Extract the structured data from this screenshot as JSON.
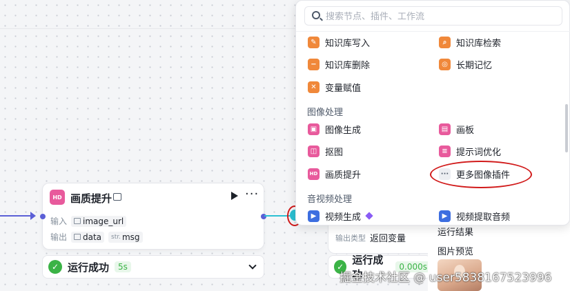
{
  "node": {
    "title": "画质提升",
    "input_label": "输入",
    "output_label": "输出",
    "input_param": "image_url",
    "output_params": [
      "data",
      "msg"
    ],
    "str_tag": "str.",
    "icon": "hd-icon"
  },
  "status_left": {
    "text": "运行成功",
    "time": "5s"
  },
  "node2": {
    "label": "输出类型",
    "value": "返回变量"
  },
  "status_right": {
    "text": "运行成功",
    "time": "0.000s"
  },
  "panel": {
    "search_placeholder": "搜索节点、插件、工作流",
    "items_top": [
      {
        "label": "知识库写入",
        "icon": "knowledge-write-icon",
        "color": "#f0883a"
      },
      {
        "label": "知识库检索",
        "icon": "knowledge-search-icon",
        "color": "#f0883a"
      },
      {
        "label": "知识库删除",
        "icon": "knowledge-delete-icon",
        "color": "#f0883a"
      },
      {
        "label": "长期记忆",
        "icon": "memory-icon",
        "color": "#f0883a"
      },
      {
        "label": "变量赋值",
        "icon": "variable-assign-icon",
        "color": "#f0883a"
      }
    ],
    "section_image": "图像处理",
    "items_image": [
      {
        "label": "图像生成",
        "icon": "image-generate-icon",
        "color": "#e85a9c"
      },
      {
        "label": "画板",
        "icon": "canvas-icon",
        "color": "#e85a9c"
      },
      {
        "label": "抠图",
        "icon": "cutout-icon",
        "color": "#e85a9c"
      },
      {
        "label": "提示词优化",
        "icon": "prompt-optimize-icon",
        "color": "#e85a9c"
      },
      {
        "label": "画质提升",
        "icon": "hd-icon",
        "color": "#e85a9c"
      },
      {
        "label": "更多图像插件",
        "icon": "more-icon",
        "color": "#eceef2"
      }
    ],
    "section_av": "音视频处理",
    "items_av": [
      {
        "label": "视频生成",
        "icon": "video-generate-icon",
        "color": "#3d6ee0"
      },
      {
        "label": "视频提取音频",
        "icon": "video-audio-icon",
        "color": "#3d6ee0"
      }
    ]
  },
  "result": {
    "title": "运行结果",
    "subtitle": "图片预览"
  },
  "watermark": "掘金技术社区 @ user5838167523996"
}
